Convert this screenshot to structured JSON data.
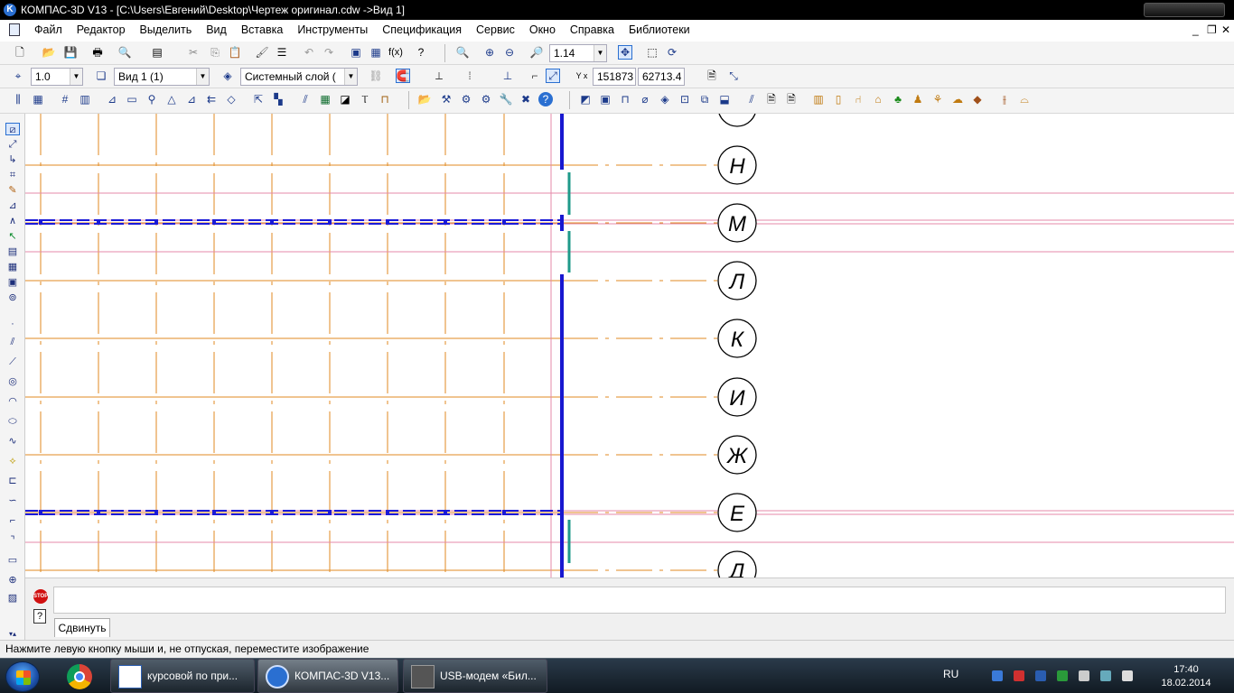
{
  "titlebar": {
    "title": "КОМПАС-3D V13 - [C:\\Users\\Евгений\\Desktop\\Чертеж оригинал.cdw ->Вид 1]"
  },
  "menu": {
    "items": [
      "Файл",
      "Редактор",
      "Выделить",
      "Вид",
      "Вставка",
      "Инструменты",
      "Спецификация",
      "Сервис",
      "Окно",
      "Справка",
      "Библиотеки"
    ]
  },
  "toolbar1": {
    "zoom_value": "1.14"
  },
  "toolbar2": {
    "step_value": "1.0",
    "view_value": "Вид 1 (1)",
    "layer_value": "Системный слой (",
    "coord_x": "151873",
    "coord_y": "62713.4"
  },
  "drawing": {
    "axis_labels": [
      "Н",
      "М",
      "Л",
      "К",
      "И",
      "Ж",
      "Е",
      "Д"
    ],
    "line_color": "#e08a20",
    "dash_color": "#1a1ad8",
    "wall_color": "#1818d0",
    "accent_color": "#1f9a8a"
  },
  "bottom": {
    "tab_label": "Сдвинуть",
    "stop_label": "STOP",
    "help_label": "?"
  },
  "statusbar": {
    "text": "Нажмите левую кнопку мыши и, не отпуская, переместите изображение"
  },
  "taskbar": {
    "apps": [
      "курсовой по при...",
      "КОМПАС-3D V13...",
      "USB-модем «Бил..."
    ],
    "lang": "RU",
    "time": "17:40",
    "date": "18.02.2014"
  }
}
